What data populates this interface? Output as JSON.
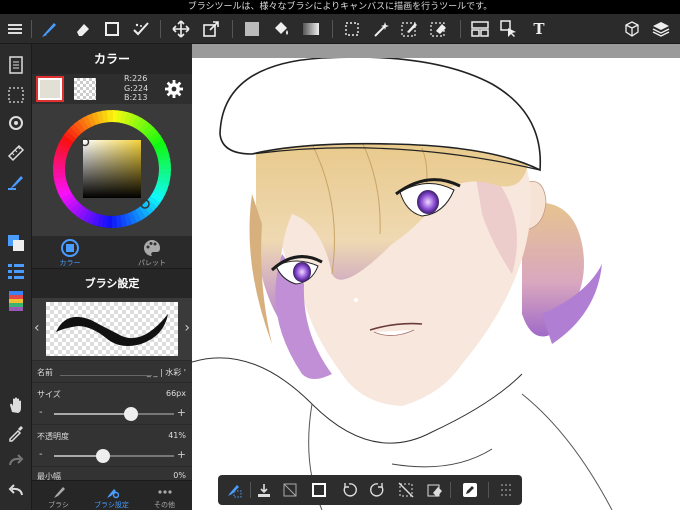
{
  "status_bar": {
    "text": "ブラシツールは、様々なブラシによりキャンバスに描画を行うツールです。"
  },
  "toolbar": {
    "menu": "menu-icon",
    "brush": "brush-icon",
    "eraser": "eraser-icon",
    "shape": "rectangle-icon",
    "blur": "blur-icon",
    "move": "move-icon",
    "transform": "transform-icon",
    "fill_color": "fill-color-icon",
    "bucket": "bucket-icon",
    "gradient": "gradient-icon",
    "select": "select-icon",
    "magic_wand": "magic-wand-icon",
    "select_pen": "select-pen-icon",
    "select_eraser": "select-eraser-icon",
    "frame_divider": "frame-divider-icon",
    "operation": "operation-icon",
    "text_label": "T",
    "3d": "3d-material-icon",
    "layers": "layers-icon"
  },
  "color_panel": {
    "title": "カラー",
    "main_color": "#e2e0d5",
    "rgb_r": "R:226",
    "rgb_g": "G:224",
    "rgb_b": "B:213",
    "tab_color": "カラー",
    "tab_palette": "パレット"
  },
  "brush_panel": {
    "title": "ブラシ設定",
    "name_label": "名前",
    "name_value": "_ _ | 水彩 '",
    "size_label": "サイズ",
    "size_value": "66px",
    "size_fraction": 0.64,
    "opacity_label": "不透明度",
    "opacity_value": "41%",
    "opacity_fraction": 0.41,
    "min_width_label": "最小幅",
    "min_width_value": "0%"
  },
  "bottom_tabs": {
    "brush": "ブラシ",
    "brush_settings": "ブラシ設定",
    "other": "その他"
  },
  "colors": {
    "accent": "#4a9cff",
    "selected_border": "#e03030"
  }
}
